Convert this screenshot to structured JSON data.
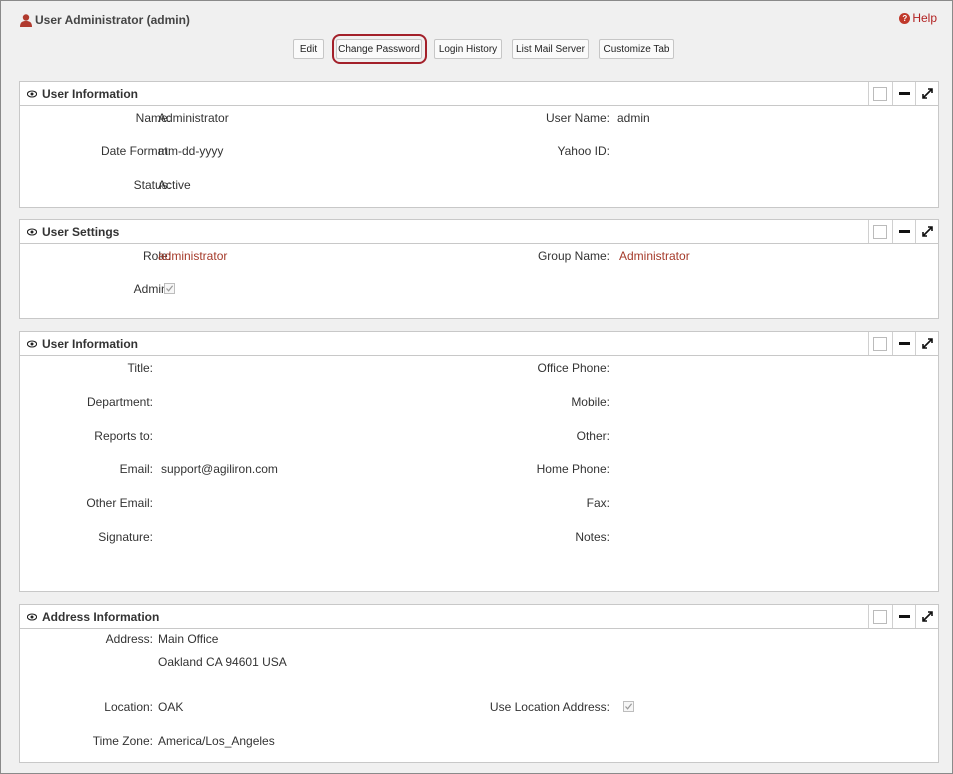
{
  "header": {
    "title": "User Administrator (admin)",
    "help_label": "Help"
  },
  "toolbar": {
    "buttons": [
      {
        "label": "Edit"
      },
      {
        "label": "Change Password"
      },
      {
        "label": "Login History"
      },
      {
        "label": "List Mail Server"
      },
      {
        "label": "Customize Tab"
      }
    ]
  },
  "panels": {
    "user_info": {
      "title": "User Information",
      "fields": {
        "name_label": "Name:",
        "name_value": "Administrator",
        "username_label": "User Name:",
        "username_value": "admin",
        "dateformat_label": "Date Format:",
        "dateformat_value": "mm-dd-yyyy",
        "yahoo_label": "Yahoo ID:",
        "status_label": "Status:",
        "status_value": "Active"
      }
    },
    "user_settings": {
      "title": "User Settings",
      "fields": {
        "role_label": "Role:",
        "role_value": "administrator",
        "group_label": "Group Name:",
        "group_value": "Administrator",
        "admin_label": "Admin:"
      },
      "admin_checked": true
    },
    "user_info2": {
      "title": "User Information",
      "fields": {
        "title_label": "Title:",
        "office_phone_label": "Office Phone:",
        "department_label": "Department:",
        "mobile_label": "Mobile:",
        "reports_to_label": "Reports to:",
        "other_label": "Other:",
        "email_label": "Email:",
        "email_value": "support@agiliron.com",
        "home_phone_label": "Home Phone:",
        "other_email_label": "Other Email:",
        "fax_label": "Fax:",
        "signature_label": "Signature:",
        "notes_label": "Notes:"
      }
    },
    "address_info": {
      "title": "Address Information",
      "fields": {
        "address_label": "Address:",
        "address_line1": "Main Office",
        "address_line2": "Oakland CA  94601 USA",
        "location_label": "Location:",
        "location_value": "OAK",
        "use_location_label": "Use Location Address:",
        "timezone_label": "Time Zone:",
        "timezone_value": "America/Los_Angeles"
      },
      "use_location_checked": true
    }
  },
  "colors": {
    "accent_red": "#a3202a",
    "link_red": "#a53a2a",
    "user_icon": "#b03a2e"
  },
  "icons": {
    "user": "user-icon",
    "help": "help-icon",
    "eye": "eye-icon",
    "box": "box-icon",
    "minus": "minus-icon",
    "expand": "expand-icon",
    "check": "check-icon"
  }
}
